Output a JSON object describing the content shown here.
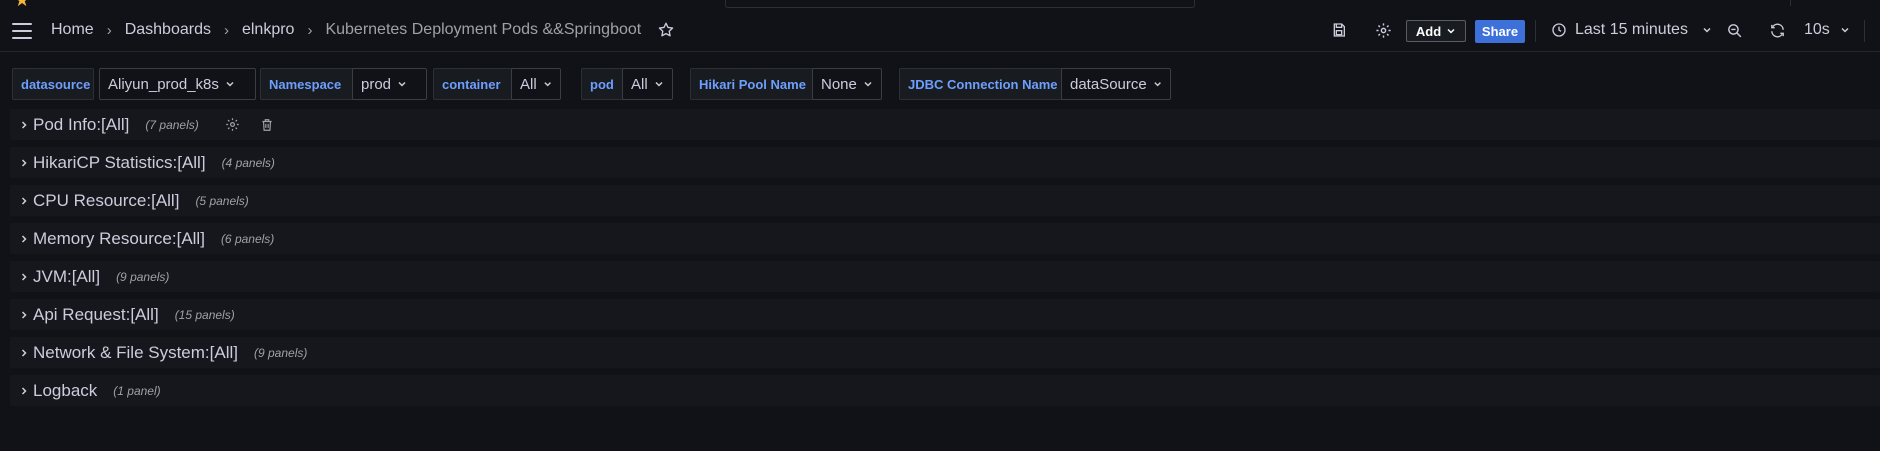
{
  "breadcrumb": {
    "items": [
      "Home",
      "Dashboards",
      "elnkpro",
      "Kubernetes Deployment Pods &&Springboot"
    ]
  },
  "toolbar": {
    "add_label": "Add",
    "share_label": "Share",
    "time_range": "Last 15 minutes",
    "refresh_interval": "10s"
  },
  "variables": [
    {
      "label": "datasource",
      "value": "Aliyun_prod_k8s"
    },
    {
      "label": "Namespace",
      "value": "prod"
    },
    {
      "label": "container",
      "value": "All"
    },
    {
      "label": "pod",
      "value": "All"
    },
    {
      "label": "Hikari Pool Name",
      "value": "None"
    },
    {
      "label": "JDBC Connection Name",
      "value": "dataSource"
    }
  ],
  "rows": [
    {
      "title": "Pod Info:[All]",
      "count": "(7 panels)"
    },
    {
      "title": "HikariCP Statistics:[All]",
      "count": "(4 panels)"
    },
    {
      "title": "CPU Resource:[All]",
      "count": "(5 panels)"
    },
    {
      "title": "Memory Resource:[All]",
      "count": "(6 panels)"
    },
    {
      "title": "JVM:[All]",
      "count": "(9 panels)"
    },
    {
      "title": "Api Request:[All]",
      "count": "(15 panels)"
    },
    {
      "title": "Network & File System:[All]",
      "count": "(9 panels)"
    },
    {
      "title": "Logback",
      "count": "(1 panel)"
    }
  ],
  "colors": {
    "background": "#111217",
    "accent_blue": "#3d71d9",
    "variable_label": "#6e9fff",
    "star": "#f5b73b"
  }
}
